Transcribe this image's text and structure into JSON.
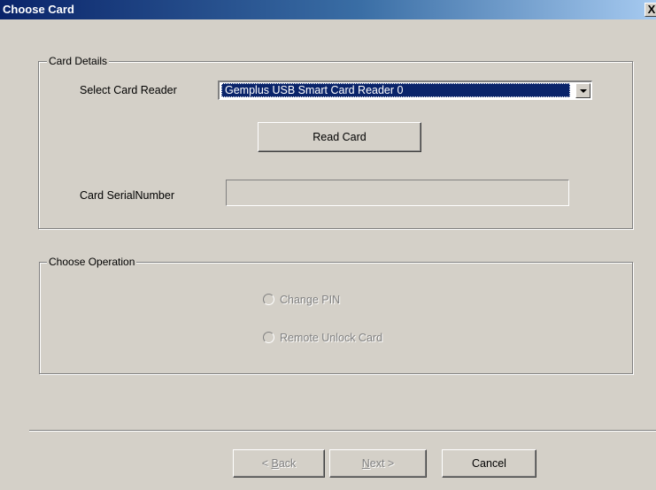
{
  "window": {
    "title": "Choose Card",
    "close_symbol": "X"
  },
  "card_details": {
    "legend": "Card Details",
    "reader_label": "Select Card Reader",
    "reader_selected": "Gemplus USB Smart Card Reader 0",
    "read_button": "Read Card",
    "serial_label": "Card SerialNumber",
    "serial_value": ""
  },
  "operation": {
    "legend": "Choose Operation",
    "options": [
      {
        "label": "Change PIN",
        "selected": false,
        "enabled": false
      },
      {
        "label": "Remote Unlock Card",
        "selected": false,
        "enabled": false
      }
    ]
  },
  "footer": {
    "back_prefix": "< ",
    "back_mnemonic": "B",
    "back_rest": "ack",
    "next_mnemonic": "N",
    "next_rest": "ext >",
    "cancel": "Cancel"
  },
  "colors": {
    "dialog_bg": "#d4d0c8",
    "titlebar_start": "#0a246a",
    "titlebar_end": "#a6caf0",
    "selection_bg": "#0a246a"
  },
  "icons": {
    "close": "close-icon",
    "dropdown": "chevron-down-icon"
  }
}
